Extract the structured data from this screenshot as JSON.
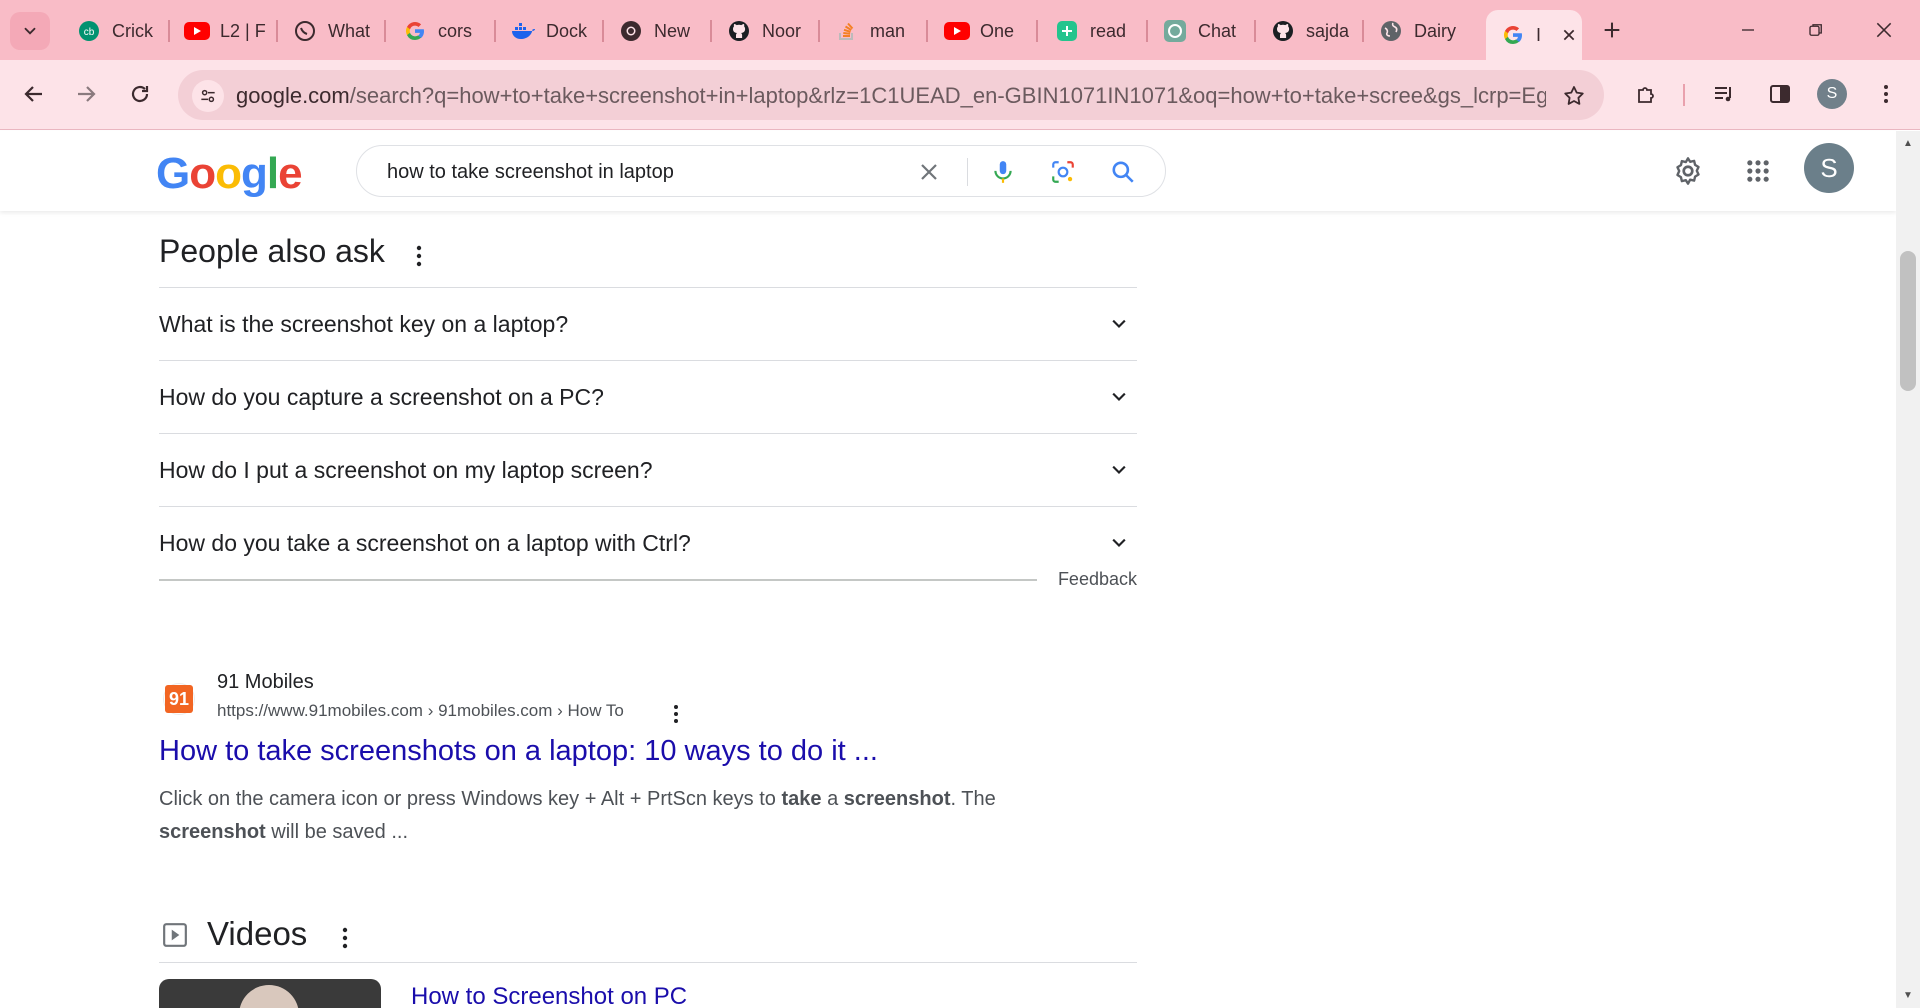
{
  "browser": {
    "tabs": [
      {
        "label": "Crick",
        "icon": "cricbuzz-icon"
      },
      {
        "label": "L2 | F",
        "icon": "youtube-icon"
      },
      {
        "label": "What",
        "icon": "whatsapp-icon"
      },
      {
        "label": "cors",
        "icon": "google-icon"
      },
      {
        "label": "Dock",
        "icon": "docker-icon"
      },
      {
        "label": "New",
        "icon": "chrome-icon"
      },
      {
        "label": "Noor",
        "icon": "github-icon"
      },
      {
        "label": "man",
        "icon": "stackoverflow-icon"
      },
      {
        "label": "One",
        "icon": "youtube-icon"
      },
      {
        "label": "read",
        "icon": "readme-icon"
      },
      {
        "label": "Chat",
        "icon": "chatgpt-icon"
      },
      {
        "label": "sajda",
        "icon": "github-icon"
      },
      {
        "label": "Dairy",
        "icon": "globe-icon"
      },
      {
        "label": "I",
        "icon": "google-icon"
      }
    ],
    "url_main": "google.com",
    "url_rest": "/search?q=how+to+take+screenshot+in+laptop&rlz=1C1UEAD_en-GBIN1071IN1071&oq=how+to+take+scree&gs_lcrp=EgZja...",
    "profile_initial": "S",
    "colors": {
      "frame": "#f9bcc7",
      "toolbar": "#fde3e8",
      "omnibox": "#f3cfd6"
    }
  },
  "google": {
    "logo_text": "Google",
    "query": "how to take screenshot in laptop",
    "avatar_initial": "S"
  },
  "paa": {
    "title": "People also ask",
    "questions": [
      "What is the screenshot key on a laptop?",
      "How do you capture a screenshot on a PC?",
      "How do I put a screenshot on my laptop screen?",
      "How do you take a screenshot on a laptop with Ctrl?"
    ],
    "feedback": "Feedback"
  },
  "result": {
    "favicon_text": "91",
    "site_name": "91 Mobiles",
    "site_url": "https://www.91mobiles.com › 91mobiles.com › How To",
    "title": "How to take screenshots on a laptop: 10 ways to do it ...",
    "snippet_parts": [
      "Click on the camera icon or press Windows key + Alt + PrtScn keys to ",
      "take",
      " a ",
      "screenshot",
      ". The ",
      "screenshot",
      " will be saved ..."
    ]
  },
  "videos": {
    "title": "Videos",
    "first_title": "How to Screenshot on PC"
  }
}
